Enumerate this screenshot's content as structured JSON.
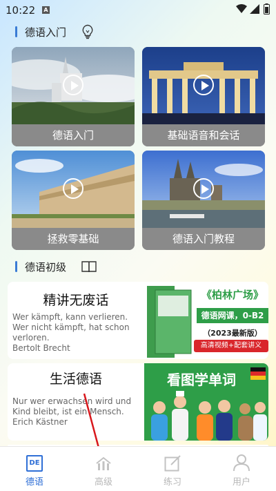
{
  "status_bar": {
    "time": "10:22",
    "app_icon_letter": "A"
  },
  "sections": {
    "intro_title": "德语入门",
    "basic_title": "德语初级"
  },
  "cards": [
    {
      "label": "德语入门"
    },
    {
      "label": "基础语音和会话"
    },
    {
      "label": "拯救零基础"
    },
    {
      "label": "德语入门教程"
    }
  ],
  "courses": [
    {
      "title": "精讲无废话",
      "quote": [
        "Wer kämpft, kann verlieren.",
        "Wer nicht kämpft, hat schon",
        "verloren.",
        "Bertolt Brecht"
      ],
      "thumb": {
        "title": "《柏林广场》",
        "subtitle": "德语网课，0-B2",
        "year": "（2023最新版）",
        "tag": "高清视频+配套讲义"
      }
    },
    {
      "title": "生活德语",
      "quote": [
        "Nur wer erwachsen wird und",
        "Kind bleibt, ist ein Mensch.",
        "Erich Kästner"
      ],
      "thumb": {
        "title": "看图学单词"
      }
    }
  ],
  "bottom_nav": [
    {
      "label": "德语",
      "icon_text": "DE",
      "active": true
    },
    {
      "label": "高级",
      "active": false
    },
    {
      "label": "练习",
      "active": false
    },
    {
      "label": "用户",
      "active": false
    }
  ],
  "colors": {
    "accent": "#2f6fd6",
    "green": "#2e9e48"
  }
}
